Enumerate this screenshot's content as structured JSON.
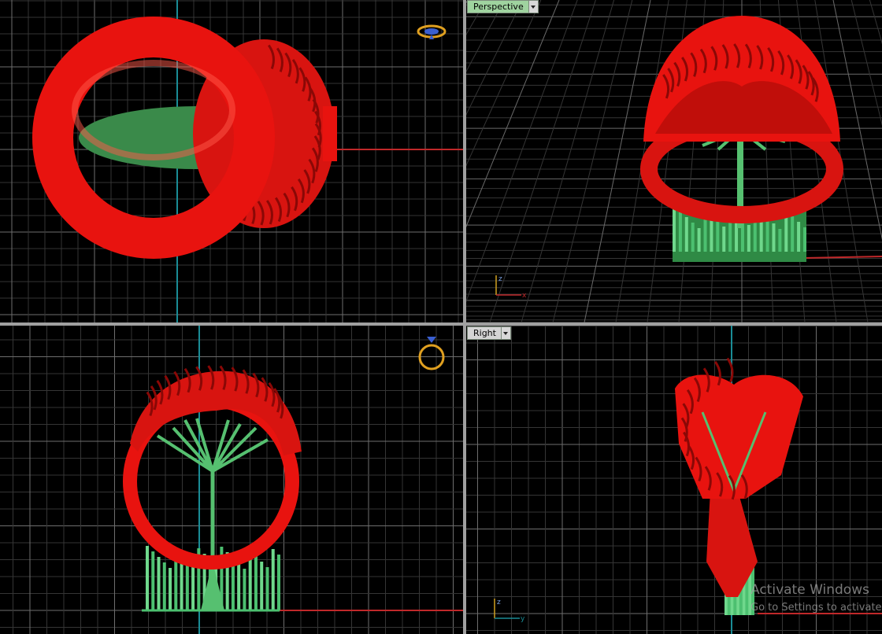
{
  "viewports": {
    "top_left": {
      "name": "",
      "mode": "orthographic"
    },
    "top_right": {
      "label": "Perspective",
      "active": true
    },
    "bottom_left": {
      "name": "",
      "mode": "orthographic"
    },
    "bottom_right": {
      "label": "Right"
    }
  },
  "axes": {
    "perspective": {
      "z": "z",
      "x": "x"
    },
    "right": {
      "z": "z",
      "y": "y"
    }
  },
  "watermark": {
    "title": "Activate Windows",
    "subtitle": "Go to Settings to activate"
  },
  "colors": {
    "background": "#000000",
    "grid_minor": "#3a3a3a",
    "grid_major": "#6e6e6e",
    "axis_x": "#c0282a",
    "axis_y": "#1a8c96",
    "model_ring": "#e8130f",
    "model_support": "#4cc070",
    "active_label_bg": "#9fd39f"
  },
  "icons": [
    "ring-preview-icon-top",
    "ring-preview-icon-front",
    "viewport-dropdown-icon",
    "axis-gizmo-icon"
  ]
}
